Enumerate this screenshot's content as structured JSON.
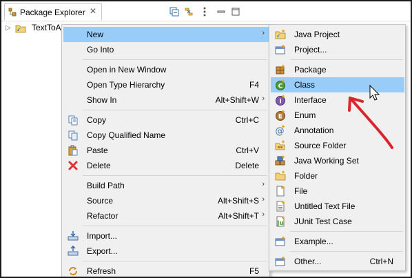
{
  "package_explorer": {
    "tab_label": "Package Explorer",
    "tab_close_glyph": "✕",
    "project_label": "TextToAu"
  },
  "context_menu": {
    "items": [
      {
        "label": "New",
        "accel": "",
        "submenu": true,
        "icon": "none"
      },
      {
        "label": "Go Into",
        "accel": "",
        "submenu": false,
        "icon": "none"
      },
      {
        "label": "Open in New Window",
        "accel": "",
        "submenu": false,
        "icon": "none"
      },
      {
        "label": "Open Type Hierarchy",
        "accel": "F4",
        "submenu": false,
        "icon": "none"
      },
      {
        "label": "Show In",
        "accel": "Alt+Shift+W",
        "submenu": true,
        "icon": "none"
      },
      {
        "label": "Copy",
        "accel": "Ctrl+C",
        "submenu": false,
        "icon": "copy-icon"
      },
      {
        "label": "Copy Qualified Name",
        "accel": "",
        "submenu": false,
        "icon": "copy-qualified-name-icon"
      },
      {
        "label": "Paste",
        "accel": "Ctrl+V",
        "submenu": false,
        "icon": "paste-icon"
      },
      {
        "label": "Delete",
        "accel": "Delete",
        "submenu": false,
        "icon": "delete-icon"
      },
      {
        "label": "Build Path",
        "accel": "",
        "submenu": true,
        "icon": "none"
      },
      {
        "label": "Source",
        "accel": "Alt+Shift+S",
        "submenu": true,
        "icon": "none"
      },
      {
        "label": "Refactor",
        "accel": "Alt+Shift+T",
        "submenu": true,
        "icon": "none"
      },
      {
        "label": "Import...",
        "accel": "",
        "submenu": false,
        "icon": "import-icon"
      },
      {
        "label": "Export...",
        "accel": "",
        "submenu": false,
        "icon": "export-icon"
      },
      {
        "label": "Refresh",
        "accel": "F5",
        "submenu": false,
        "icon": "refresh-icon"
      }
    ],
    "arrow_glyph": "›"
  },
  "new_submenu": {
    "items": [
      {
        "label": "Java Project",
        "accel": "",
        "icon": "java-project-icon"
      },
      {
        "label": "Project...",
        "accel": "",
        "icon": "project-icon"
      },
      {
        "label": "Package",
        "accel": "",
        "icon": "package-icon"
      },
      {
        "label": "Class",
        "accel": "",
        "icon": "class-icon"
      },
      {
        "label": "Interface",
        "accel": "",
        "icon": "interface-icon"
      },
      {
        "label": "Enum",
        "accel": "",
        "icon": "enum-icon"
      },
      {
        "label": "Annotation",
        "accel": "",
        "icon": "annotation-icon"
      },
      {
        "label": "Source Folder",
        "accel": "",
        "icon": "source-folder-icon"
      },
      {
        "label": "Java Working Set",
        "accel": "",
        "icon": "java-working-set-icon"
      },
      {
        "label": "Folder",
        "accel": "",
        "icon": "folder-icon"
      },
      {
        "label": "File",
        "accel": "",
        "icon": "file-icon"
      },
      {
        "label": "Untitled Text File",
        "accel": "",
        "icon": "untitled-text-file-icon"
      },
      {
        "label": "JUnit Test Case",
        "accel": "",
        "icon": "junit-test-case-icon"
      },
      {
        "label": "Example...",
        "accel": "",
        "icon": "example-icon"
      },
      {
        "label": "Other...",
        "accel": "Ctrl+N",
        "icon": "other-icon"
      }
    ],
    "highlighted": "Class"
  },
  "colors": {
    "highlight": "#99ccf6",
    "menu_bg": "#f0f0f0",
    "annotation_arrow": "#d9262c"
  }
}
